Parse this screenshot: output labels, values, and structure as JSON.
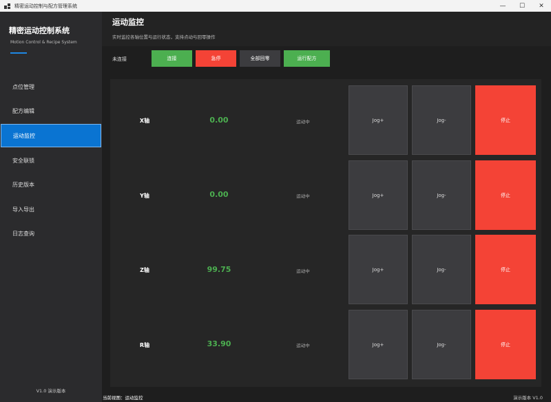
{
  "window": {
    "title": "精密运动控制与配方管理系统",
    "minimize": "—",
    "maximize": "☐",
    "close": "✕"
  },
  "sidebar": {
    "brand_title": "精密运动控制系统",
    "brand_subtitle": "Motion Control & Recipe System",
    "items": [
      {
        "label": "点位管理"
      },
      {
        "label": "配方编辑"
      },
      {
        "label": "运动监控"
      },
      {
        "label": "安全联锁"
      },
      {
        "label": "历史版本"
      },
      {
        "label": "导入导出"
      },
      {
        "label": "日志查询"
      }
    ],
    "active_index": 2,
    "version": "V1.0 演示版本"
  },
  "header": {
    "title": "运动监控",
    "subtitle": "实时监控各轴位置与运行状态，支持点动与回零操作"
  },
  "toolbar": {
    "connection_status": "未连接",
    "connect": "连接",
    "estop": "急停",
    "home_all": "全部回零",
    "run_recipe": "运行配方"
  },
  "axes": [
    {
      "name": "X轴",
      "position": "0.00",
      "state": "运动中",
      "jog_plus": "Jog+",
      "jog_minus": "Jog-",
      "stop": "停止"
    },
    {
      "name": "Y轴",
      "position": "0.00",
      "state": "运动中",
      "jog_plus": "Jog+",
      "jog_minus": "Jog-",
      "stop": "停止"
    },
    {
      "name": "Z轴",
      "position": "99.75",
      "state": "运动中",
      "jog_plus": "Jog+",
      "jog_minus": "Jog-",
      "stop": "停止"
    },
    {
      "name": "R轴",
      "position": "33.90",
      "state": "运动中",
      "jog_plus": "Jog+",
      "jog_minus": "Jog-",
      "stop": "停止"
    }
  ],
  "statusbar": {
    "current_view": "当前视图：运动监控",
    "version": "演示版本 V1.0"
  },
  "colors": {
    "accent": "#0a74d2",
    "success": "#4caf50",
    "danger": "#f44336",
    "neutral_button": "#3c3c3f"
  }
}
